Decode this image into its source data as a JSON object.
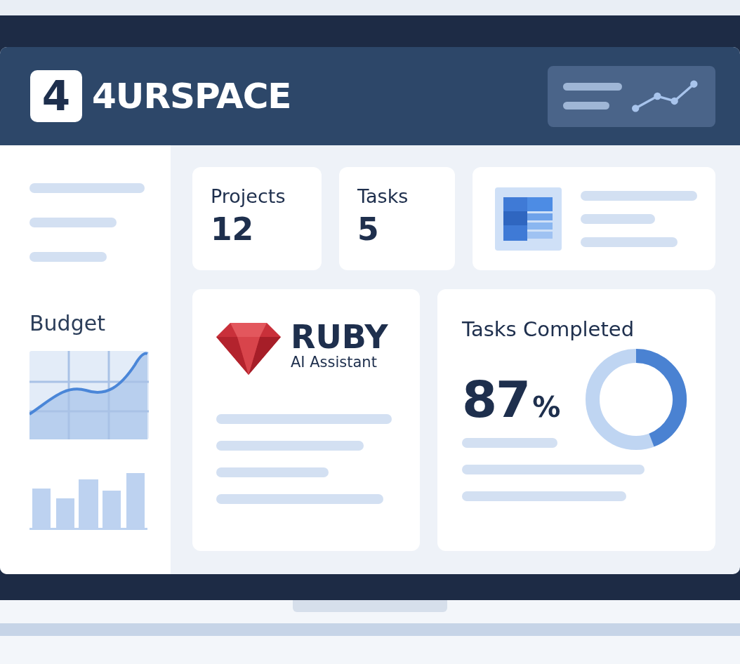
{
  "brand": {
    "logo_mark": "4",
    "name": "4URSPACE"
  },
  "sidebar": {
    "budget_label": "Budget"
  },
  "stats": [
    {
      "label": "Projects",
      "value": "12"
    },
    {
      "label": "Tasks",
      "value": "5"
    }
  ],
  "assistant": {
    "title": "RUBY",
    "subtitle": "AI Assistant"
  },
  "completion": {
    "title": "Tasks Completed",
    "value": "87",
    "unit": "%"
  }
}
